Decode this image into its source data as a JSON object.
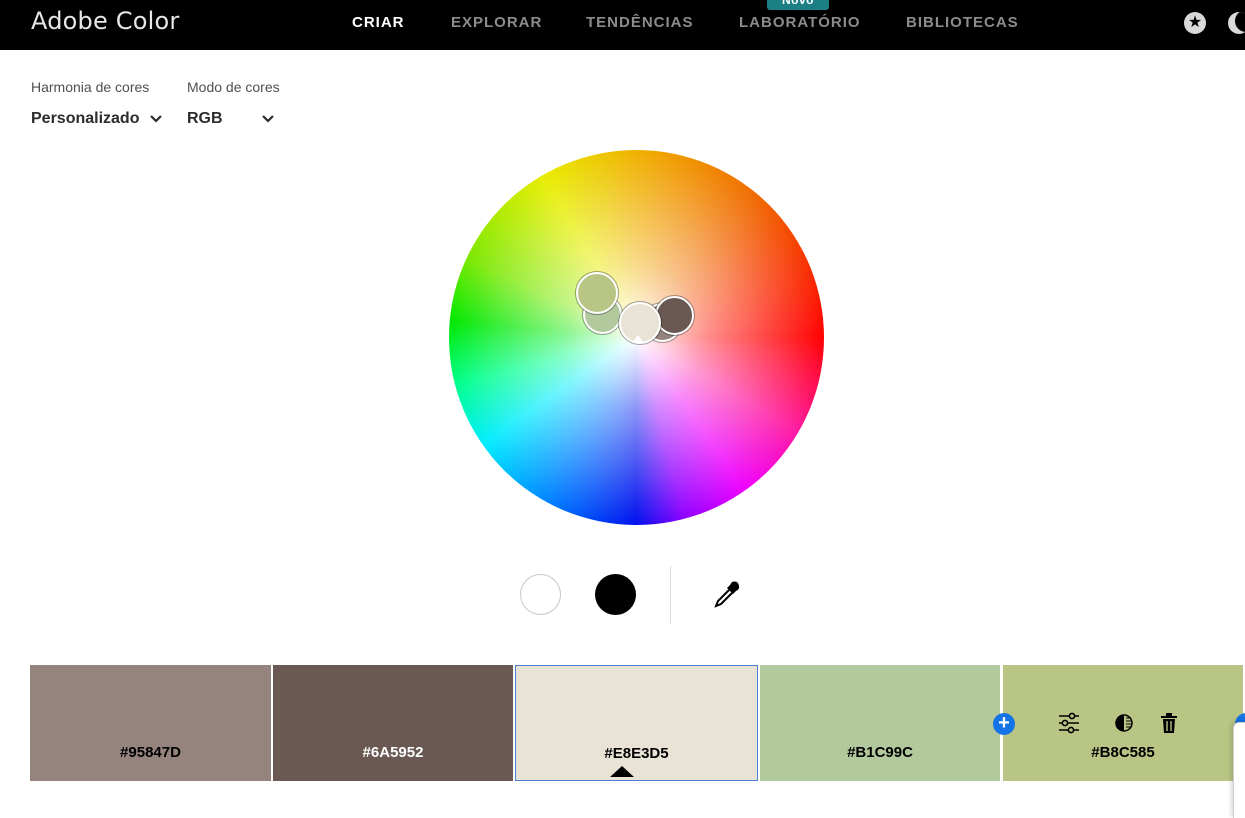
{
  "app": {
    "title": "Adobe Color"
  },
  "nav": {
    "items": [
      {
        "label": "CRIAR",
        "active": true
      },
      {
        "label": "EXPLORAR"
      },
      {
        "label": "TENDÊNCIAS"
      },
      {
        "label": "LABORATÓRIO",
        "badge": "Novo"
      },
      {
        "label": "BIBLIOTECAS"
      }
    ]
  },
  "controls": {
    "harmony_label": "Harmonia de cores",
    "harmony_value": "Personalizado",
    "mode_label": "Modo de cores",
    "mode_value": "RGB"
  },
  "wheel": {
    "markers": [
      {
        "color": "#B8C585",
        "icon": "color-marker"
      },
      {
        "color": "#B1C99C",
        "icon": "color-marker"
      },
      {
        "color": "#95847D",
        "icon": "color-marker"
      },
      {
        "color": "#6A5952",
        "icon": "color-marker"
      },
      {
        "color": "#E8E3D5",
        "icon": "color-marker",
        "selected": true
      }
    ]
  },
  "tools": {
    "white_icon": "white-circle-icon",
    "black_icon": "black-circle-icon",
    "eyedropper_icon": "eyedropper-icon"
  },
  "swatches": [
    {
      "hex": "#95847D",
      "color": "#95847D",
      "text_color": "#000000"
    },
    {
      "hex": "#6A5952",
      "color": "#6A5952",
      "text_color": "#ffffff"
    },
    {
      "hex": "#E8E3D5",
      "color": "#E8E3D5",
      "text_color": "#000000",
      "selected": true
    },
    {
      "hex": "#B1C99C",
      "color": "#B1C99C",
      "text_color": "#000000"
    },
    {
      "hex": "#B8C585",
      "color": "#B8C585",
      "text_color": "#000000"
    }
  ],
  "swatch_actions": [
    "add-swatch-icon",
    "sliders-icon",
    "contrast-icon",
    "trash-icon"
  ]
}
